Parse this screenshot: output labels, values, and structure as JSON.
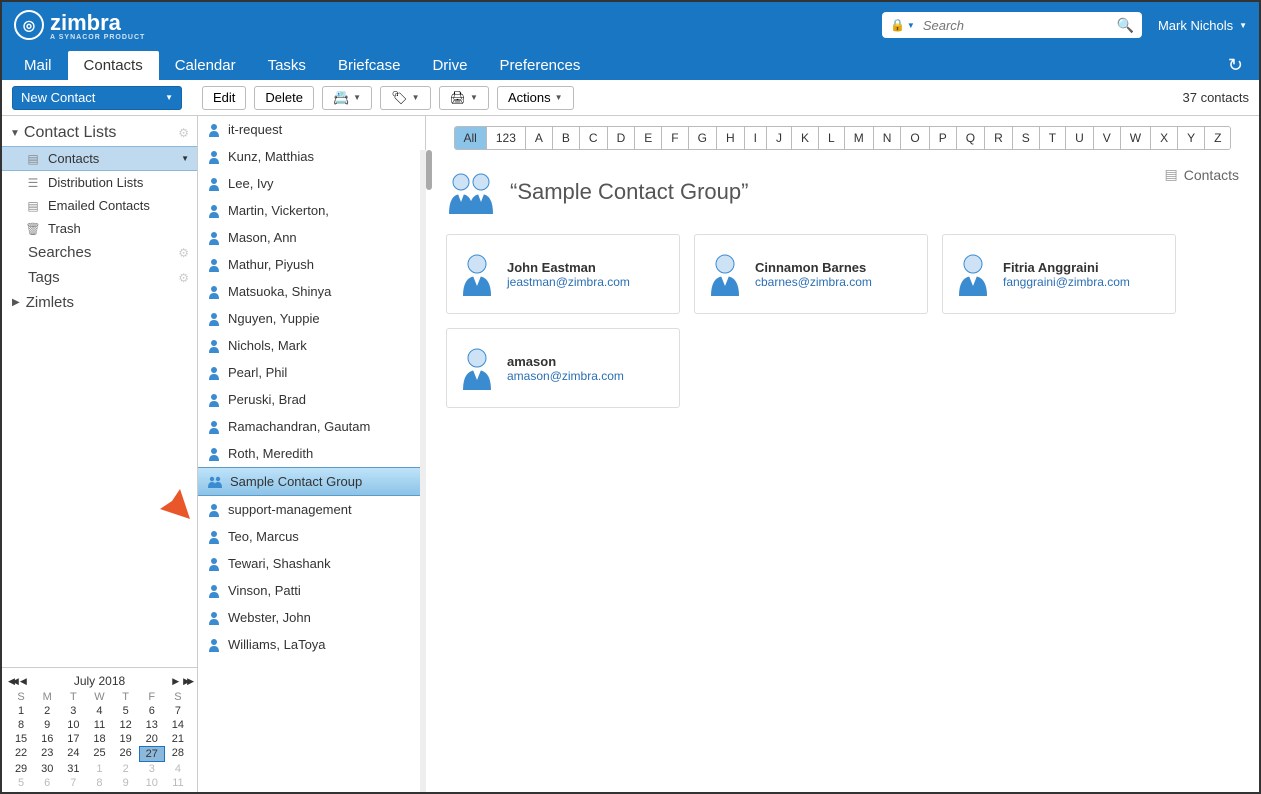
{
  "brand": {
    "name": "zimbra",
    "tagline": "A SYNACOR PRODUCT"
  },
  "search": {
    "placeholder": "Search"
  },
  "user": {
    "name": "Mark Nichols"
  },
  "tabs": [
    "Mail",
    "Contacts",
    "Calendar",
    "Tasks",
    "Briefcase",
    "Drive",
    "Preferences"
  ],
  "active_tab": "Contacts",
  "toolbar": {
    "new_contact": "New Contact",
    "edit": "Edit",
    "delete": "Delete",
    "actions": "Actions",
    "count": "37 contacts"
  },
  "sidebar": {
    "lists_header": "Contact Lists",
    "items": [
      {
        "label": "Contacts",
        "selected": true,
        "caret": true,
        "icon": "book"
      },
      {
        "label": "Distribution Lists",
        "icon": "list"
      },
      {
        "label": "Emailed Contacts",
        "icon": "book"
      },
      {
        "label": "Trash",
        "icon": "trash"
      }
    ],
    "searches": "Searches",
    "tags": "Tags",
    "zimlets": "Zimlets"
  },
  "alpha": [
    "All",
    "123",
    "A",
    "B",
    "C",
    "D",
    "E",
    "F",
    "G",
    "H",
    "I",
    "J",
    "K",
    "L",
    "M",
    "N",
    "O",
    "P",
    "Q",
    "R",
    "S",
    "T",
    "U",
    "V",
    "W",
    "X",
    "Y",
    "Z"
  ],
  "alpha_selected": "All",
  "contacts": [
    {
      "name": "it-request",
      "type": "person"
    },
    {
      "name": "Kunz, Matthias",
      "type": "person"
    },
    {
      "name": "Lee, Ivy",
      "type": "person"
    },
    {
      "name": "Martin, Vickerton,",
      "type": "person"
    },
    {
      "name": "Mason, Ann",
      "type": "person"
    },
    {
      "name": "Mathur, Piyush",
      "type": "person"
    },
    {
      "name": "Matsuoka, Shinya",
      "type": "person"
    },
    {
      "name": "Nguyen, Yuppie",
      "type": "person"
    },
    {
      "name": "Nichols, Mark",
      "type": "person"
    },
    {
      "name": "Pearl, Phil",
      "type": "person"
    },
    {
      "name": "Peruski, Brad",
      "type": "person"
    },
    {
      "name": "Ramachandran, Gautam",
      "type": "person"
    },
    {
      "name": "Roth, Meredith",
      "type": "person"
    },
    {
      "name": "Sample Contact Group",
      "type": "group",
      "selected": true
    },
    {
      "name": "support-management",
      "type": "person"
    },
    {
      "name": "Teo, Marcus",
      "type": "person"
    },
    {
      "name": "Tewari, Shashank",
      "type": "person"
    },
    {
      "name": "Vinson, Patti",
      "type": "person"
    },
    {
      "name": "Webster, John",
      "type": "person"
    },
    {
      "name": "Williams, LaToya",
      "type": "person"
    }
  ],
  "detail": {
    "location_label": "Contacts",
    "title": "“Sample Contact Group”",
    "members": [
      {
        "name": "John Eastman",
        "email": "jeastman@zimbra.com"
      },
      {
        "name": "Cinnamon Barnes",
        "email": "cbarnes@zimbra.com"
      },
      {
        "name": "Fitria Anggraini",
        "email": "fanggraini@zimbra.com"
      },
      {
        "name": "amason",
        "email": "amason@zimbra.com"
      }
    ]
  },
  "calendar": {
    "title": "July 2018",
    "dow": [
      "S",
      "M",
      "T",
      "W",
      "T",
      "F",
      "S"
    ],
    "weeks": [
      [
        {
          "d": 1
        },
        {
          "d": 2
        },
        {
          "d": 3
        },
        {
          "d": 4
        },
        {
          "d": 5
        },
        {
          "d": 6
        },
        {
          "d": 7
        }
      ],
      [
        {
          "d": 8
        },
        {
          "d": 9
        },
        {
          "d": 10
        },
        {
          "d": 11
        },
        {
          "d": 12
        },
        {
          "d": 13
        },
        {
          "d": 14
        }
      ],
      [
        {
          "d": 15
        },
        {
          "d": 16
        },
        {
          "d": 17
        },
        {
          "d": 18
        },
        {
          "d": 19
        },
        {
          "d": 20
        },
        {
          "d": 21
        }
      ],
      [
        {
          "d": 22
        },
        {
          "d": 23
        },
        {
          "d": 24
        },
        {
          "d": 25
        },
        {
          "d": 26
        },
        {
          "d": 27,
          "today": true
        },
        {
          "d": 28
        }
      ],
      [
        {
          "d": 29
        },
        {
          "d": 30
        },
        {
          "d": 31
        },
        {
          "d": 1,
          "o": true
        },
        {
          "d": 2,
          "o": true
        },
        {
          "d": 3,
          "o": true
        },
        {
          "d": 4,
          "o": true
        }
      ],
      [
        {
          "d": 5,
          "o": true
        },
        {
          "d": 6,
          "o": true
        },
        {
          "d": 7,
          "o": true
        },
        {
          "d": 8,
          "o": true
        },
        {
          "d": 9,
          "o": true
        },
        {
          "d": 10,
          "o": true
        },
        {
          "d": 11,
          "o": true
        }
      ]
    ]
  }
}
